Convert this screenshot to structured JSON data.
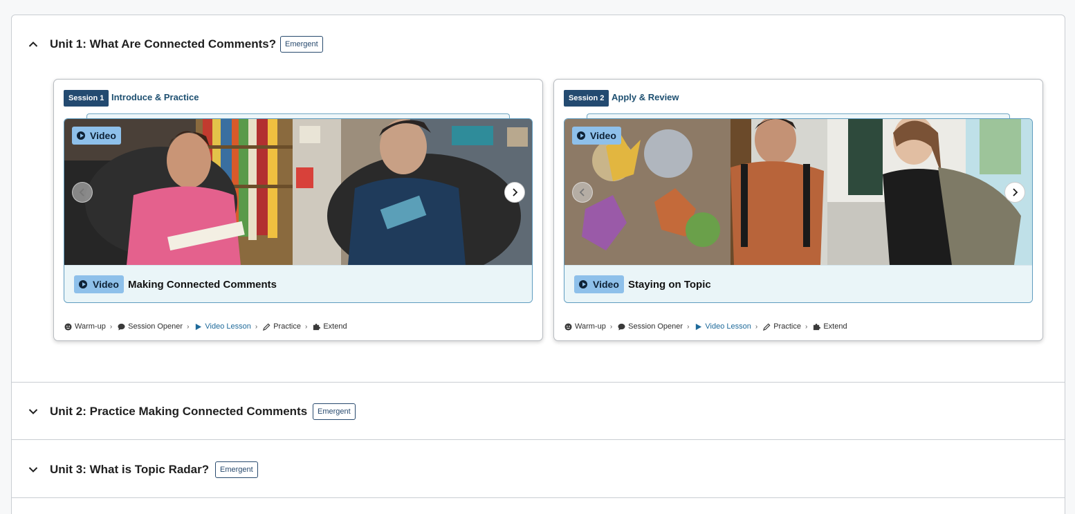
{
  "units": [
    {
      "title": "Unit 1: What Are Connected Comments?",
      "badge": "Emergent",
      "expanded": true,
      "chevron": "chevron-up-icon"
    },
    {
      "title": "Unit 2: Practice Making Connected Comments",
      "badge": "Emergent",
      "expanded": false,
      "chevron": "chevron-down-icon"
    },
    {
      "title": "Unit 3: What is Topic Radar?",
      "badge": "Emergent",
      "expanded": false,
      "chevron": "chevron-down-icon"
    }
  ],
  "sessions": [
    {
      "tag": "Session 1",
      "name": "Introduce & Practice",
      "thumb_label": "Video",
      "caption_label": "Video",
      "caption_title": "Making Connected Comments",
      "steps": [
        "Warm-up",
        "Session Opener",
        "Video Lesson",
        "Practice",
        "Extend"
      ]
    },
    {
      "tag": "Session 2",
      "name": "Apply & Review",
      "thumb_label": "Video",
      "caption_label": "Video",
      "caption_title": "Staying on Topic",
      "steps": [
        "Warm-up",
        "Session Opener",
        "Video Lesson",
        "Practice",
        "Extend"
      ]
    }
  ],
  "colors": {
    "session_tag": "#234a70",
    "session_name": "#1d4f70",
    "video_pill": "#8ec0ea",
    "active_step": "#1e6a9a",
    "caption_bg": "#eaf5f8",
    "badge_border": "#27496d"
  }
}
